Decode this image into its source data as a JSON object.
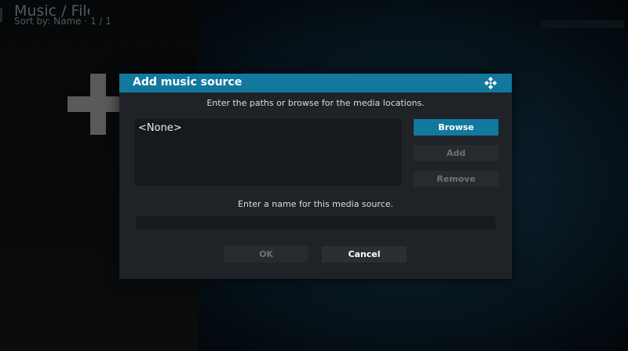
{
  "background": {
    "header_title": "Music / Files",
    "sort_text": "Sort by: Name  ·  1 / 1",
    "add_icon": "plus-icon"
  },
  "dialog": {
    "title": "Add music source",
    "logo_icon": "kodi-logo-icon",
    "instructions": "Enter the paths or browse for the media locations.",
    "paths": [
      "<None>"
    ],
    "buttons": {
      "browse": "Browse",
      "add": "Add",
      "remove": "Remove",
      "ok": "OK",
      "cancel": "Cancel"
    },
    "name_label": "Enter a name for this media source.",
    "name_value": ""
  },
  "colors": {
    "accent": "#12789e",
    "dialog_bg": "#1f2327",
    "field_bg": "#161a1d",
    "disabled_text": "#6c7276"
  }
}
